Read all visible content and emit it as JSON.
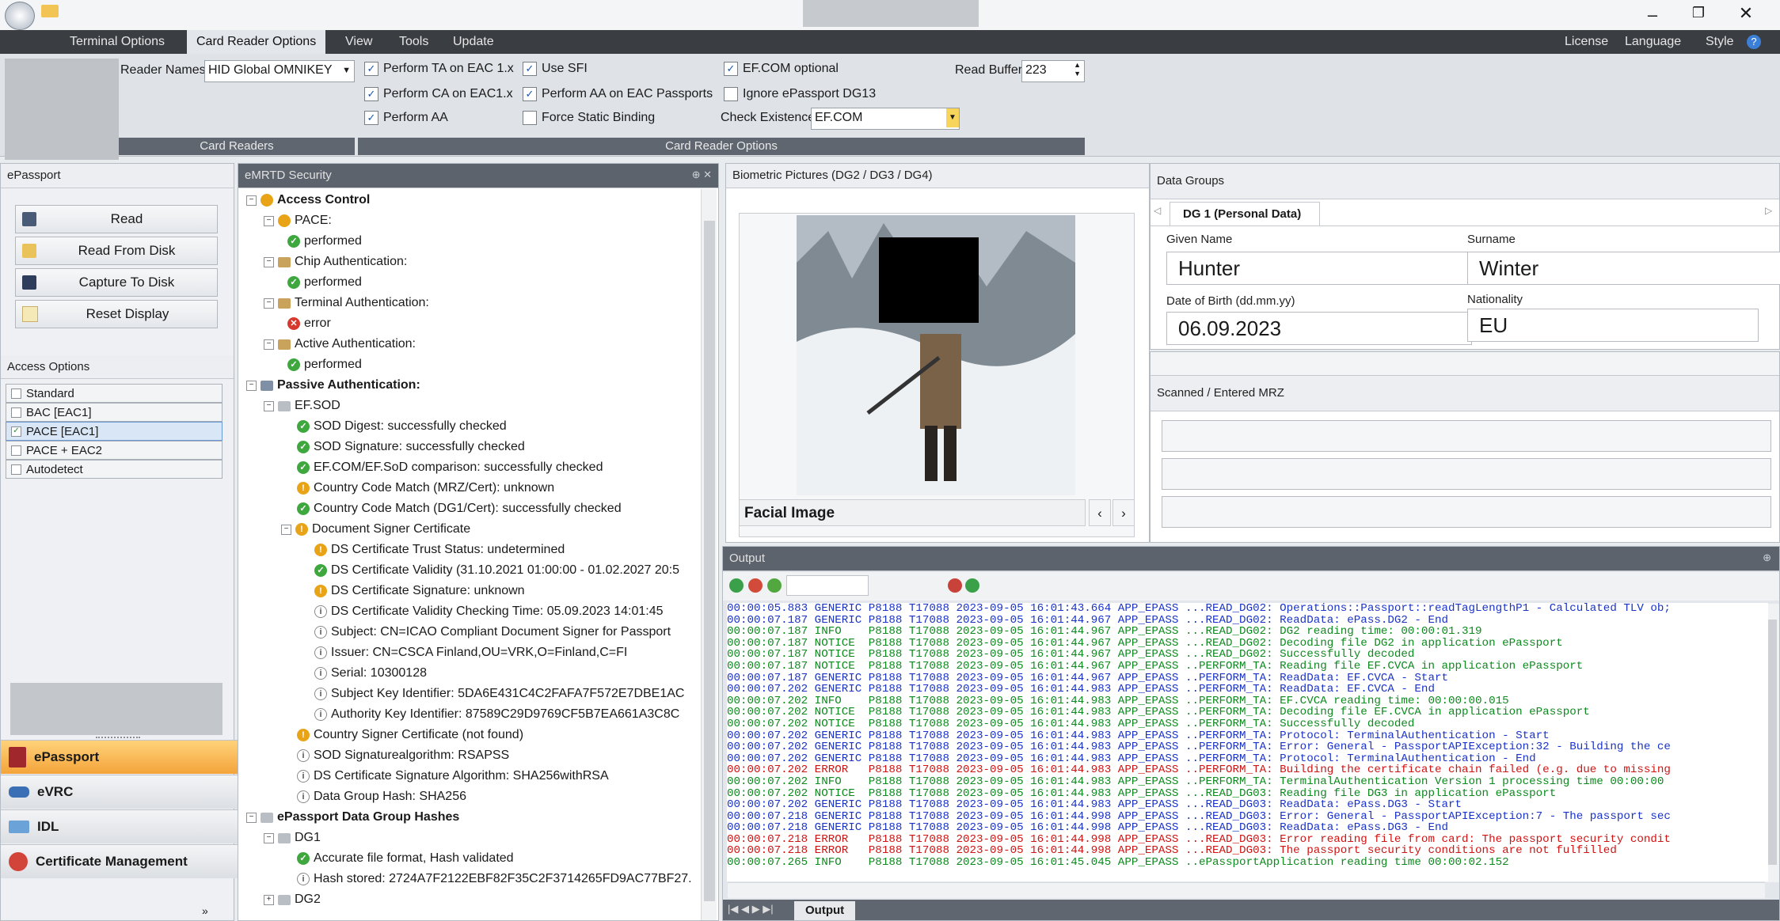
{
  "menu": {
    "tabs": [
      "Terminal Options",
      "Card Reader Options",
      "View",
      "Tools",
      "Update"
    ],
    "active": "Card Reader Options",
    "right": [
      "License",
      "Language",
      "Style"
    ]
  },
  "ribbon": {
    "reader_names_label": "Reader Names",
    "reader_names_value": "HID Global OMNIKEY",
    "group1_caption": "Card Readers",
    "group2_caption": "Card Reader Options",
    "checks": [
      {
        "label": "Perform TA on EAC 1.x",
        "checked": true
      },
      {
        "label": "Use SFI",
        "checked": true
      },
      {
        "label": "EF.COM optional",
        "checked": true
      },
      {
        "label": "Perform CA on EAC1.x",
        "checked": true
      },
      {
        "label": "Perform AA on EAC Passports",
        "checked": true
      },
      {
        "label": "Ignore ePassport DG13",
        "checked": false
      },
      {
        "label": "Perform AA",
        "checked": true
      },
      {
        "label": "Force Static Binding",
        "checked": false
      }
    ],
    "read_buffer_label": "Read Buffer",
    "read_buffer_value": "223",
    "check_existence_label": "Check Existence",
    "check_existence_value": "EF.COM"
  },
  "left": {
    "title": "ePassport",
    "buttons": [
      "Read",
      "Read From Disk",
      "Capture To Disk",
      "Reset Display"
    ],
    "access_title": "Access Options",
    "access_options": [
      {
        "label": "Standard",
        "selected": false
      },
      {
        "label": "BAC [EAC1]",
        "selected": false
      },
      {
        "label": "PACE [EAC1]",
        "selected": true
      },
      {
        "label": "PACE + EAC2",
        "selected": false
      },
      {
        "label": "Autodetect",
        "selected": false
      }
    ],
    "nav": [
      "ePassport",
      "eVRC",
      "IDL",
      "Certificate Management"
    ],
    "nav_active": "ePassport"
  },
  "security": {
    "title": "eMRTD Security",
    "rows": [
      "Access Control",
      "PACE:",
      "performed",
      "Chip Authentication:",
      "performed",
      "Terminal Authentication:",
      "error",
      "Active Authentication:",
      "performed",
      "Passive Authentication:",
      "EF.SOD",
      "SOD Digest: successfully checked",
      "SOD Signature: successfully checked",
      "EF.COM/EF.SoD comparison: successfully checked",
      "Country Code Match (MRZ/Cert): unknown",
      "Country Code Match (DG1/Cert): successfully checked",
      "Document Signer Certificate",
      "DS Certificate Trust Status: undetermined",
      "DS Certificate Validity (31.10.2021 01:00:00 - 01.02.2027 20:5",
      "DS Certificate Signature: unknown",
      "DS Certificate Validity Checking Time: 05.09.2023 14:01:45",
      "Subject: CN=ICAO Compliant Document Signer for Passport",
      "Issuer: CN=CSCA Finland,OU=VRK,O=Finland,C=FI",
      "Serial: 10300128",
      "Subject Key Identifier: 5DA6E431C4C2FAFA7F572E7DBE1AC",
      "Authority Key Identifier: 87589C29D9769CF5B7EA661A3C8C",
      "Country Signer Certificate (not found)",
      "SOD Signaturealgorithm: RSAPSS",
      "DS Certificate Signature Algorithm: SHA256withRSA",
      "Data Group Hash: SHA256",
      "ePassport Data Group Hashes",
      "DG1",
      "Accurate file format, Hash validated",
      "Hash stored: 2724A7F2122EBF82F35C2F3714265FD9AC77BF27.",
      "DG2"
    ]
  },
  "biometric": {
    "title": "Biometric Pictures (DG2 / DG3 / DG4)",
    "caption": "Facial Image"
  },
  "datagroups": {
    "title": "Data Groups",
    "tab": "DG 1 (Personal Data)",
    "given_name_label": "Given Name",
    "given_name": "Hunter",
    "surname_label": "Surname",
    "surname": "Winter",
    "dob_label": "Date of Birth (dd.mm.yy)",
    "dob": "06.09.2023",
    "nationality_label": "Nationality",
    "nationality": "EU"
  },
  "mrz": {
    "title": "Scanned / Entered MRZ"
  },
  "output": {
    "title": "Output",
    "tab": "Output",
    "lines": [
      {
        "c": "blue",
        "t": "00:00:05.883 GENERIC P8188 T17088 2023-09-05 16:01:43.664 APP_EPASS ...READ_DG02: Operations::Passport::readTagLengthP1 - Calculated TLV ob;"
      },
      {
        "c": "blue",
        "t": "00:00:07.187 GENERIC P8188 T17088 2023-09-05 16:01:44.967 APP_EPASS ...READ_DG02: ReadData: ePass.DG2 - End"
      },
      {
        "c": "green",
        "t": "00:00:07.187 INFO    P8188 T17088 2023-09-05 16:01:44.967 APP_EPASS ...READ_DG02: DG2 reading time: 00:00:01.319"
      },
      {
        "c": "green",
        "t": "00:00:07.187 NOTICE  P8188 T17088 2023-09-05 16:01:44.967 APP_EPASS ...READ_DG02: Decoding file DG2 in application ePassport"
      },
      {
        "c": "green",
        "t": "00:00:07.187 NOTICE  P8188 T17088 2023-09-05 16:01:44.967 APP_EPASS ...READ_DG02: Successfully decoded"
      },
      {
        "c": "green",
        "t": "00:00:07.187 NOTICE  P8188 T17088 2023-09-05 16:01:44.967 APP_EPASS ..PERFORM_TA: Reading file EF.CVCA in application ePassport"
      },
      {
        "c": "blue",
        "t": "00:00:07.187 GENERIC P8188 T17088 2023-09-05 16:01:44.967 APP_EPASS ..PERFORM_TA: ReadData: EF.CVCA - Start"
      },
      {
        "c": "blue",
        "t": "00:00:07.202 GENERIC P8188 T17088 2023-09-05 16:01:44.983 APP_EPASS ..PERFORM_TA: ReadData: EF.CVCA - End"
      },
      {
        "c": "green",
        "t": "00:00:07.202 INFO    P8188 T17088 2023-09-05 16:01:44.983 APP_EPASS ..PERFORM_TA: EF.CVCA reading time: 00:00:00.015"
      },
      {
        "c": "green",
        "t": "00:00:07.202 NOTICE  P8188 T17088 2023-09-05 16:01:44.983 APP_EPASS ..PERFORM_TA: Decoding file EF.CVCA in application ePassport"
      },
      {
        "c": "green",
        "t": "00:00:07.202 NOTICE  P8188 T17088 2023-09-05 16:01:44.983 APP_EPASS ..PERFORM_TA: Successfully decoded"
      },
      {
        "c": "blue",
        "t": "00:00:07.202 GENERIC P8188 T17088 2023-09-05 16:01:44.983 APP_EPASS ..PERFORM_TA: Protocol: TerminalAuthentication - Start"
      },
      {
        "c": "blue",
        "t": "00:00:07.202 GENERIC P8188 T17088 2023-09-05 16:01:44.983 APP_EPASS ..PERFORM_TA: Error: General - PassportAPIException:32 - Building the ce"
      },
      {
        "c": "blue",
        "t": "00:00:07.202 GENERIC P8188 T17088 2023-09-05 16:01:44.983 APP_EPASS ..PERFORM_TA: Protocol: TerminalAuthentication - End"
      },
      {
        "c": "red",
        "t": "00:00:07.202 ERROR   P8188 T17088 2023-09-05 16:01:44.983 APP_EPASS ..PERFORM_TA: Building the certificate chain failed (e.g. due to missing"
      },
      {
        "c": "green",
        "t": "00:00:07.202 INFO    P8188 T17088 2023-09-05 16:01:44.983 APP_EPASS ..PERFORM_TA: TerminalAuthentication Version 1 processing time 00:00:00"
      },
      {
        "c": "green",
        "t": "00:00:07.202 NOTICE  P8188 T17088 2023-09-05 16:01:44.983 APP_EPASS ...READ_DG03: Reading file DG3 in application ePassport"
      },
      {
        "c": "blue",
        "t": "00:00:07.202 GENERIC P8188 T17088 2023-09-05 16:01:44.983 APP_EPASS ...READ_DG03: ReadData: ePass.DG3 - Start"
      },
      {
        "c": "blue",
        "t": "00:00:07.218 GENERIC P8188 T17088 2023-09-05 16:01:44.998 APP_EPASS ...READ_DG03: Error: General - PassportAPIException:7 - The passport sec"
      },
      {
        "c": "blue",
        "t": "00:00:07.218 GENERIC P8188 T17088 2023-09-05 16:01:44.998 APP_EPASS ...READ_DG03: ReadData: ePass.DG3 - End"
      },
      {
        "c": "red",
        "t": "00:00:07.218 ERROR   P8188 T17088 2023-09-05 16:01:44.998 APP_EPASS ...READ_DG03: Error reading file from card: The passport security condit"
      },
      {
        "c": "red",
        "t": "00:00:07.218 ERROR   P8188 T17088 2023-09-05 16:01:44.998 APP_EPASS ...READ_DG03: The passport security conditions are not fulfilled"
      },
      {
        "c": "green",
        "t": "00:00:07.265 INFO    P8188 T17088 2023-09-05 16:01:45.045 APP_EPASS ..ePassportApplication reading time 00:00:02.152"
      }
    ]
  }
}
